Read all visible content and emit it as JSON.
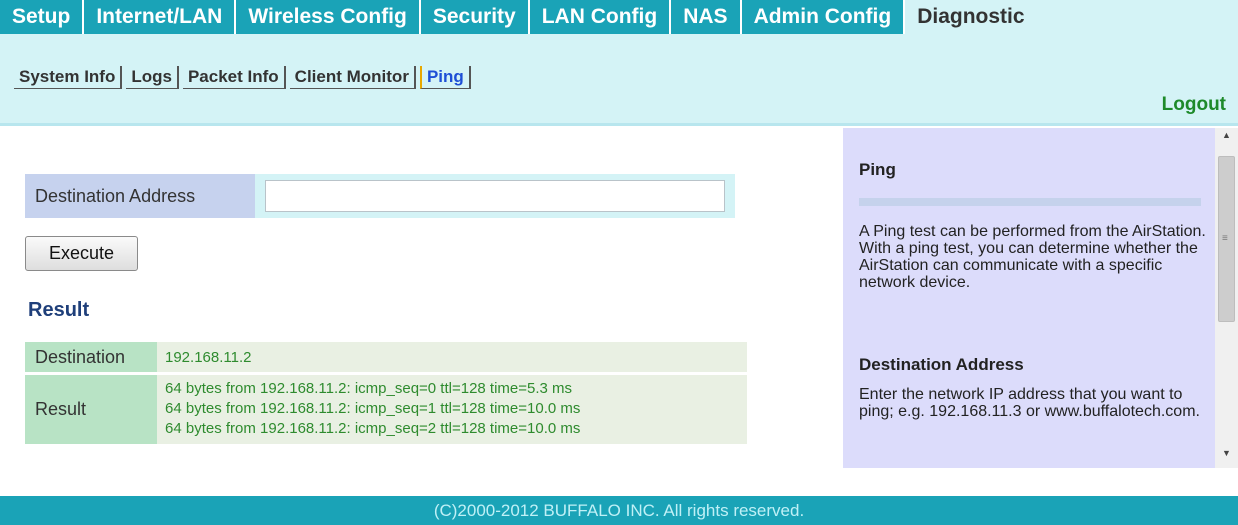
{
  "nav": {
    "tabs": [
      {
        "label": "Setup"
      },
      {
        "label": "Internet/LAN"
      },
      {
        "label": "Wireless Config"
      },
      {
        "label": "Security"
      },
      {
        "label": "LAN Config"
      },
      {
        "label": "NAS"
      },
      {
        "label": "Admin Config"
      },
      {
        "label": "Diagnostic"
      }
    ],
    "subtabs": [
      {
        "label": "System Info"
      },
      {
        "label": "Logs"
      },
      {
        "label": "Packet Info"
      },
      {
        "label": "Client Monitor"
      },
      {
        "label": "Ping"
      }
    ],
    "logout_label": "Logout"
  },
  "form": {
    "destination_label": "Destination Address",
    "destination_value": "",
    "execute_label": "Execute"
  },
  "result": {
    "heading": "Result",
    "destination_label": "Destination",
    "destination_value": "192.168.11.2",
    "result_label": "Result",
    "lines": [
      "64 bytes from 192.168.11.2: icmp_seq=0 ttl=128 time=5.3 ms",
      "64 bytes from 192.168.11.2: icmp_seq=1 ttl=128 time=10.0 ms",
      "64 bytes from 192.168.11.2: icmp_seq=2 ttl=128 time=10.0 ms"
    ]
  },
  "help": {
    "title": "Ping",
    "paragraph1": "A Ping test can be performed from the AirStation. With a ping test, you can determine whether the AirStation can communicate with a specific network device.",
    "heading2": "Destination Address",
    "paragraph2": "Enter the network IP address that you want to ping; e.g. 192.168.11.3 or www.buffalotech.com."
  },
  "footer": {
    "text": "(C)2000-2012 BUFFALO INC. All rights reserved."
  },
  "colors": {
    "accent": "#1aa3b7",
    "nav_bg": "#d4f3f6",
    "help_bg": "#dcdcfb",
    "result_text": "#2e8b2e",
    "logout": "#1e8a2a"
  }
}
